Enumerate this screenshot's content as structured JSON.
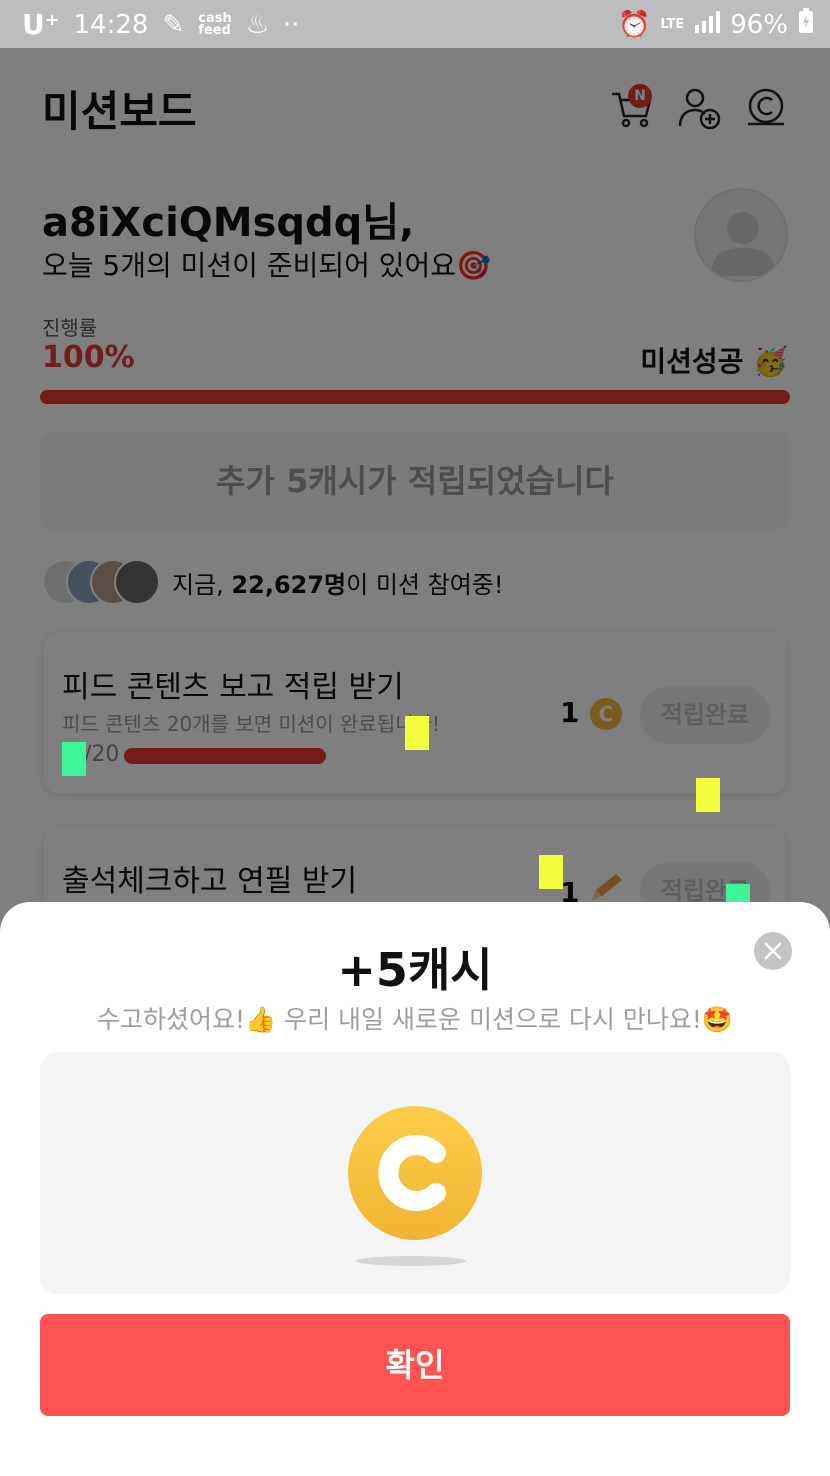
{
  "status_bar": {
    "carrier": "U⁺",
    "time": "14:28",
    "cashfeed_line1": "cash",
    "cashfeed_line2": "feed",
    "network": "LTE",
    "battery": "96%"
  },
  "header": {
    "title": "미션보드",
    "cart_badge": "N",
    "icons": [
      "cart-icon",
      "add-friend-icon",
      "cash-coin-icon"
    ]
  },
  "greeting": {
    "name": "a8iXciQMsqdq님,",
    "subtitle": "오늘 5개의 미션이 준비되어 있어요🎯"
  },
  "progress": {
    "label": "진행률",
    "value": "100%",
    "fraction": 1.0,
    "status": "미션성공 🥳"
  },
  "bonus_notice": "추가 5캐시가 적립되었습니다",
  "participants": {
    "prefix": "지금, ",
    "count": "22,627명",
    "suffix": "이 미션 참여중!"
  },
  "missions": [
    {
      "title": "피드 콘텐츠 보고 적립 받기",
      "description": "피드 콘텐츠 20개를 보면 미션이 완료됩니다!",
      "count": "/20",
      "reward": "1",
      "reward_icon": "coin-icon",
      "button": "적립완료"
    },
    {
      "title": "출석체크하고 연필 받기",
      "reward": "1",
      "reward_icon": "pencil-icon",
      "button": "적립완료"
    }
  ],
  "reward_sheet": {
    "title": "+5캐시",
    "subtitle": "수고하셨어요!👍 우리 내일 새로운 미션으로 다시 만나요!🤩",
    "confirm": "확인",
    "close_icon": "close-icon"
  },
  "colors": {
    "accent_red": "#e53935",
    "confirm_red": "#ff5252",
    "coin_gold": "#f3b93b"
  }
}
